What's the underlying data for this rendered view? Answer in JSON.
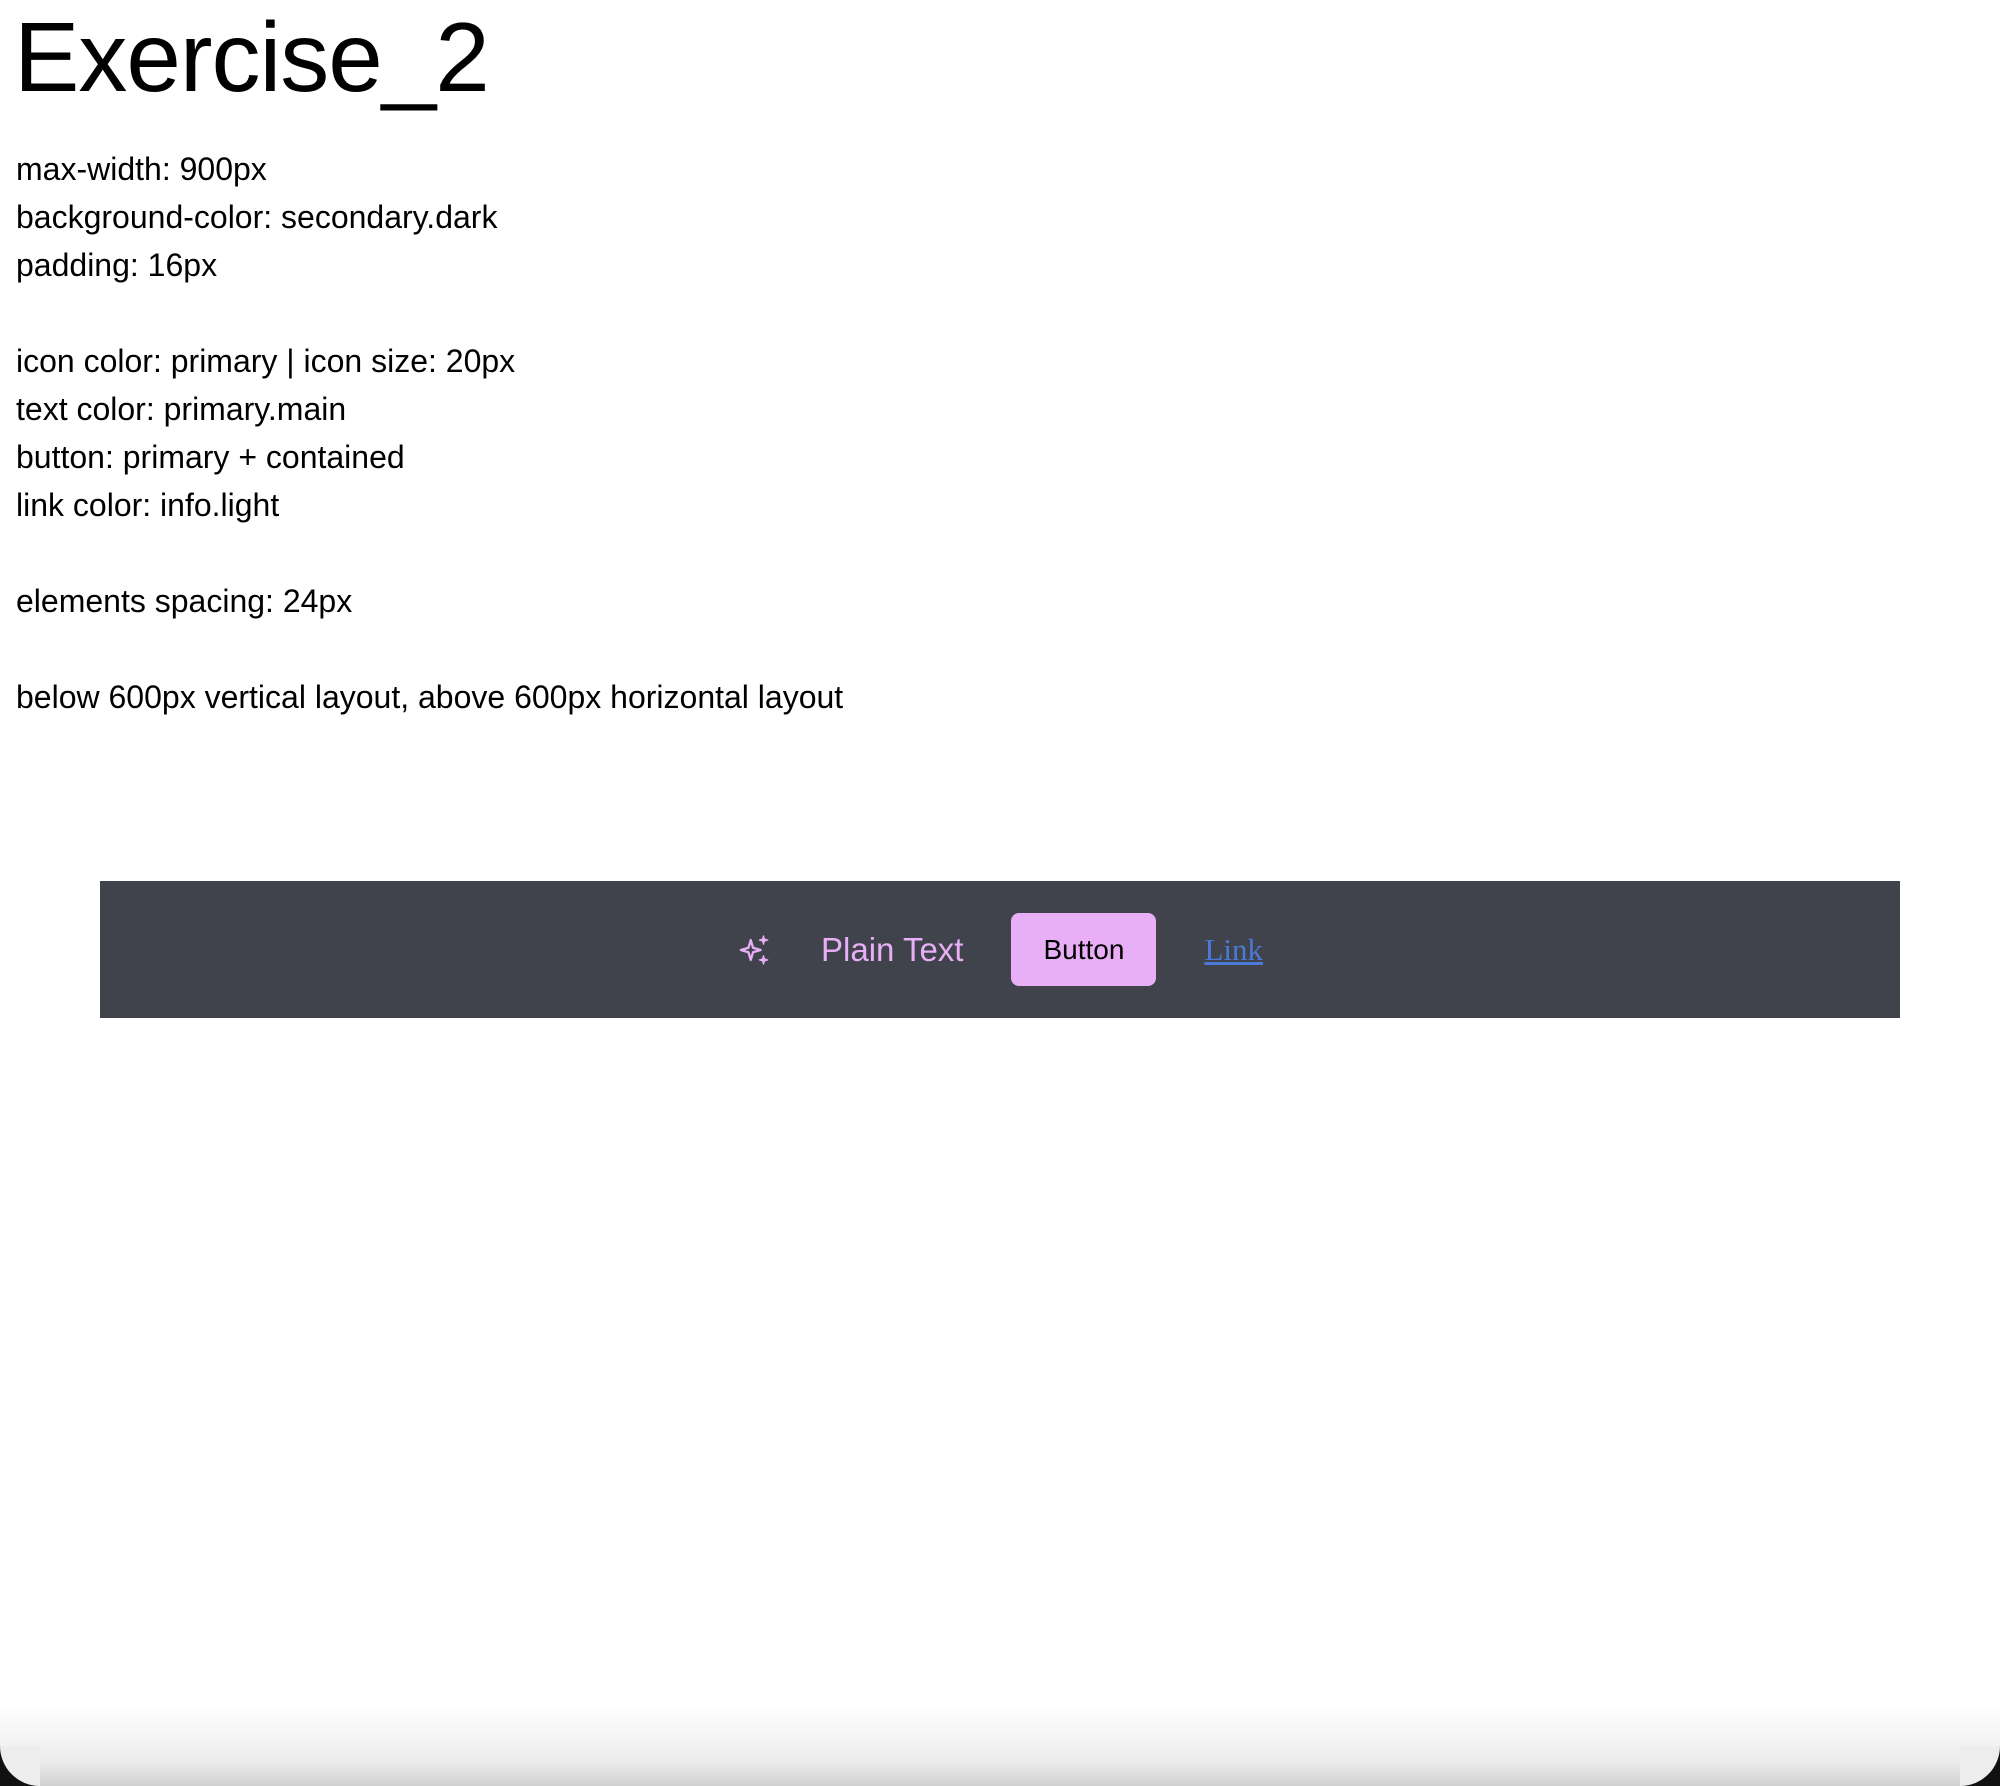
{
  "page": {
    "title": "Exercise_2"
  },
  "spec": {
    "block1": [
      "max-width: 900px",
      "background-color: secondary.dark",
      "padding: 16px"
    ],
    "block2": [
      "icon color: primary | icon size: 20px",
      "text color: primary.main",
      "button: primary + contained",
      "link color: info.light"
    ],
    "block3": [
      "elements spacing: 24px"
    ],
    "block4": [
      "below 600px vertical layout, above 600px horizontal layout"
    ]
  },
  "demo": {
    "icon": "sparkle-icon",
    "plain_text": "Plain Text",
    "button_label": "Button",
    "link_label": "Link",
    "colors": {
      "bar_background": "#40434b",
      "primary": "#e8aef6",
      "link": "#4a7ad6"
    }
  }
}
